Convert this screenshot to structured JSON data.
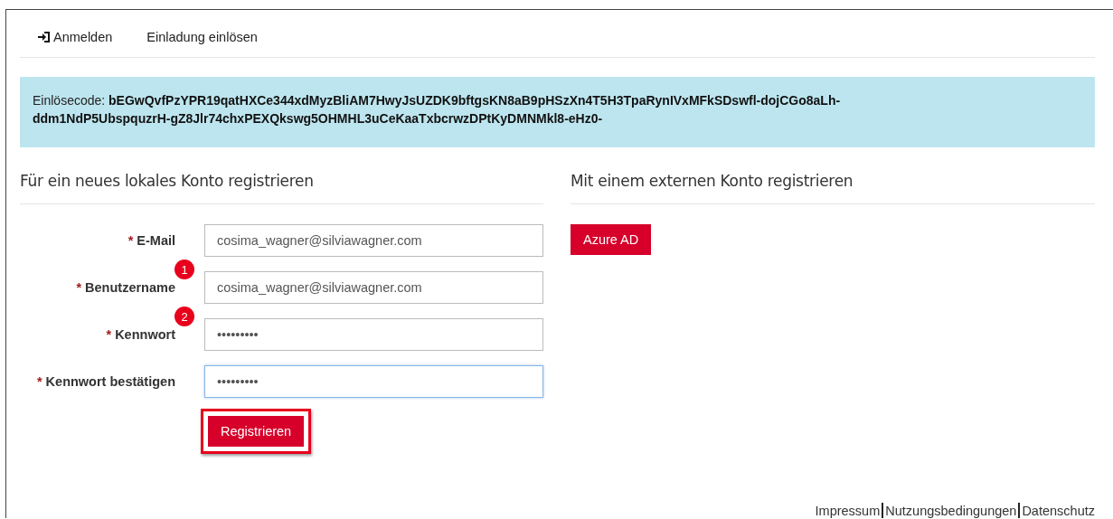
{
  "nav": [
    {
      "label": "Anmelden",
      "icon": true
    },
    {
      "label": "Einladung einlösen",
      "icon": false
    }
  ],
  "alert": {
    "label": "Einlösecode:",
    "code_lines": [
      "bEGwQvfPzYPR19qatHXCe344xdMyzBliAM7HwyJsUZDK9bftgsKN8aB9pHSzXn4T5H3TpaRynIVxMFkSDswfl-dojCGo8aLh-",
      "ddm1NdP5UbspquzrH-gZ8Jlr74chxPEXQkswg5OHMHL3uCeKaaTxbcrwzDPtKyDMNMkl8-eHz0-"
    ]
  },
  "local": {
    "heading": "Für ein neues lokales Konto registrieren",
    "fields": [
      {
        "required": "*",
        "label": "E-Mail",
        "value": "cosima_wagner@silviawagner.com",
        "focused": false
      },
      {
        "required": "*",
        "label": "Benutzername",
        "value": "cosima_wagner@silviawagner.com",
        "focused": false,
        "badge": "1"
      },
      {
        "required": "*",
        "label": "Kennwort",
        "value": "•••••••••",
        "focused": false,
        "badge": "2"
      },
      {
        "required": "*",
        "label": "Kennwort bestätigen",
        "value": "•••••••••",
        "focused": true
      }
    ],
    "submit": {
      "label": "Registrieren",
      "highlighted": true
    }
  },
  "external": {
    "heading": "Mit einem externen Konto registrieren",
    "buttons": [
      "Azure AD"
    ]
  },
  "footer": [
    "Impressum",
    "Nutzungsbedingungen",
    "Datenschutz"
  ]
}
